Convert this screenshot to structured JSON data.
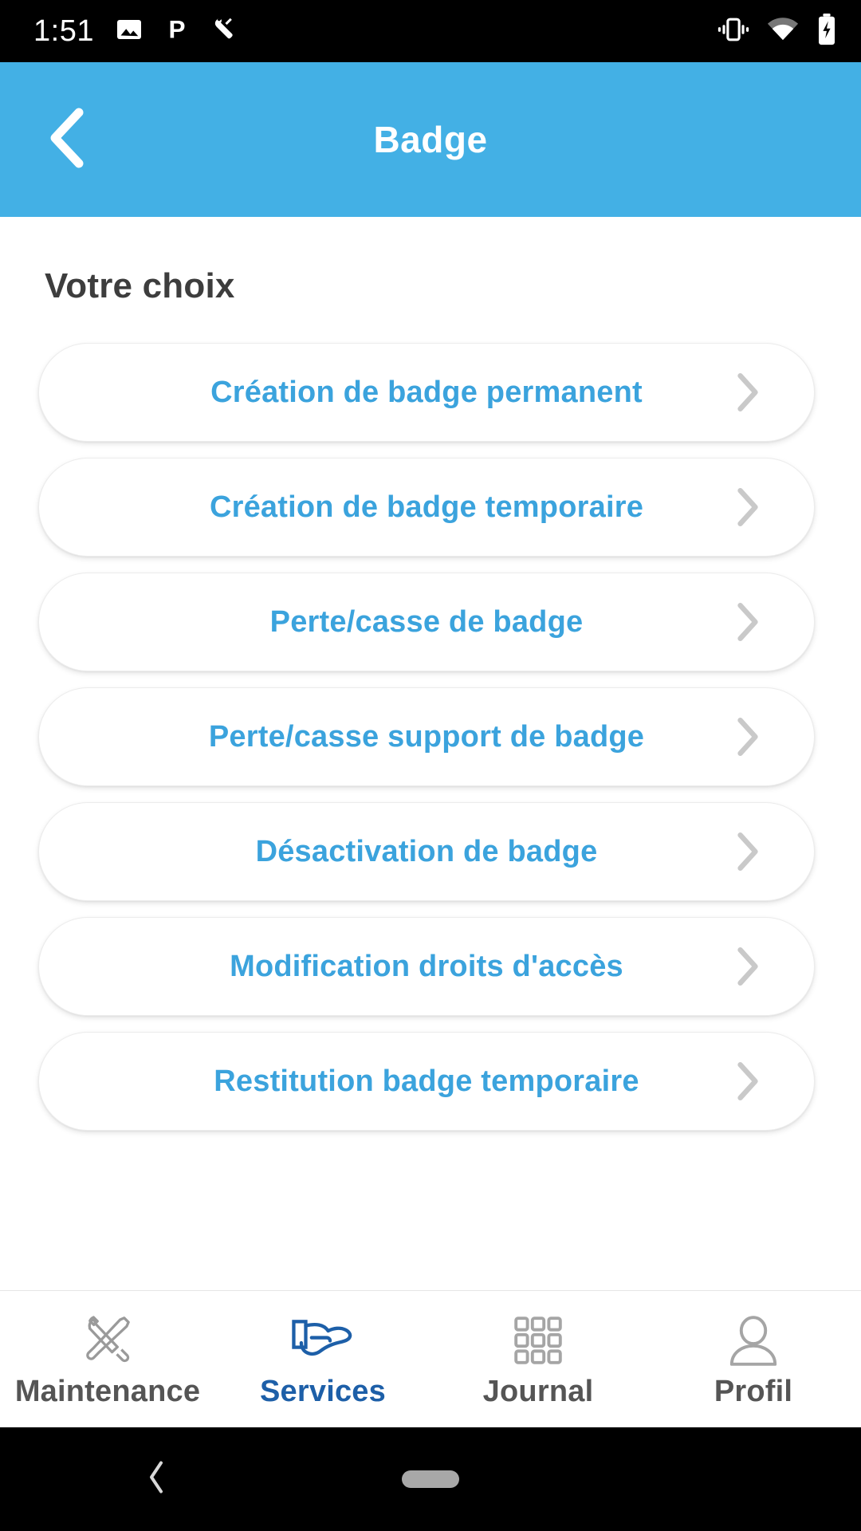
{
  "status_bar": {
    "time": "1:51",
    "left_icons": [
      "image-icon",
      "parking-p-icon",
      "wrench-icon"
    ],
    "right_icons": [
      "vibrate-icon",
      "wifi-icon",
      "battery-charging-icon"
    ]
  },
  "header": {
    "title": "Badge",
    "back_icon": "chevron-left-icon",
    "background_color": "#43b0e5"
  },
  "main": {
    "section_title": "Votre choix",
    "accent_color": "#3ba3dd",
    "items": [
      {
        "label": "Création de badge permanent",
        "chevron": "chevron-right-icon"
      },
      {
        "label": "Création de badge temporaire",
        "chevron": "chevron-right-icon"
      },
      {
        "label": "Perte/casse de badge",
        "chevron": "chevron-right-icon"
      },
      {
        "label": "Perte/casse support de badge",
        "chevron": "chevron-right-icon"
      },
      {
        "label": "Désactivation de badge",
        "chevron": "chevron-right-icon"
      },
      {
        "label": "Modification droits d'accès",
        "chevron": "chevron-right-icon"
      },
      {
        "label": "Restitution badge temporaire",
        "chevron": "chevron-right-icon"
      }
    ]
  },
  "bottom_nav": {
    "active_color": "#1d5fa8",
    "inactive_color": "#555555",
    "items": [
      {
        "label": "Maintenance",
        "icon": "tools-icon",
        "active": false
      },
      {
        "label": "Services",
        "icon": "hand-offer-icon",
        "active": true
      },
      {
        "label": "Journal",
        "icon": "grid-icon",
        "active": false
      },
      {
        "label": "Profil",
        "icon": "person-icon",
        "active": false
      }
    ]
  },
  "android_nav": {
    "back_icon": "chevron-left-icon",
    "home_icon": "home-pill-icon"
  }
}
